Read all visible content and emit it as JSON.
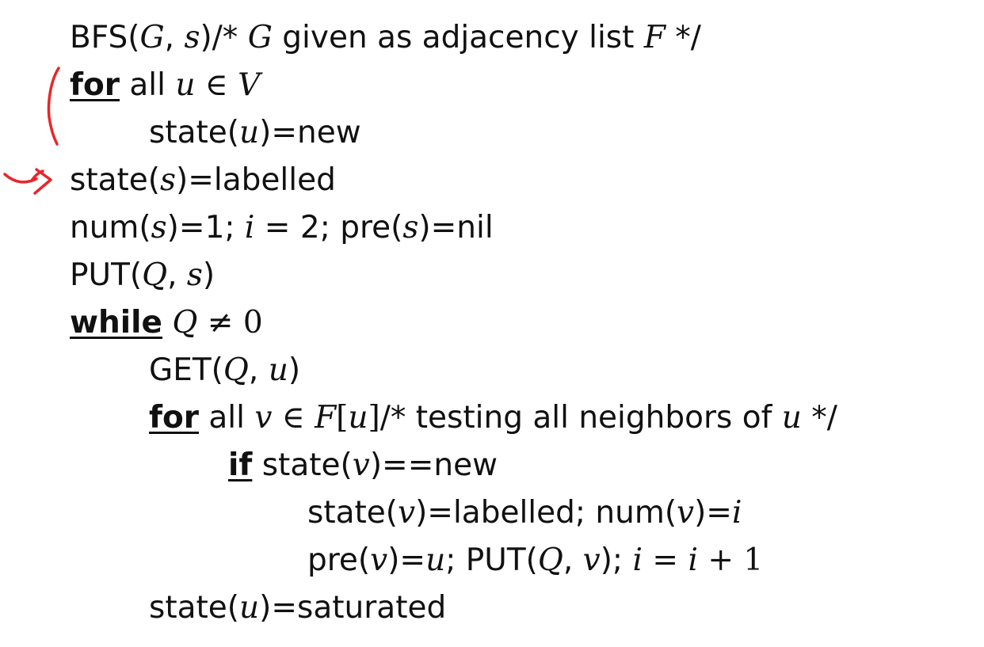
{
  "lines": [
    {
      "parts": [
        "BFS(",
        "G",
        ", ",
        "s",
        ")",
        "/* ",
        "G",
        " given as adjacency list ",
        "F",
        " */"
      ]
    },
    {
      "parts": [
        "for",
        " all ",
        "u",
        " ∈ ",
        "V"
      ]
    },
    {
      "parts": [
        "state(",
        "u",
        ")=new"
      ]
    },
    {
      "parts": [
        "state(",
        "s",
        ")=labelled"
      ]
    },
    {
      "parts": [
        "num(",
        "s",
        ")=1; ",
        "i",
        " = 2; pre(",
        "s",
        ")=nil"
      ]
    },
    {
      "parts": [
        "PUT(",
        "Q",
        ", ",
        "s",
        ")"
      ]
    },
    {
      "parts": [
        "while",
        " ",
        "Q",
        " ≠ 0"
      ]
    },
    {
      "parts": [
        "GET(",
        "Q",
        ", ",
        "u",
        ")"
      ]
    },
    {
      "parts": [
        "for",
        " all ",
        "v",
        " ∈ ",
        "F",
        "[",
        "u",
        "]",
        "/* testing all neighbors of ",
        "u",
        " */"
      ]
    },
    {
      "parts": [
        "if",
        " state(",
        "v",
        ")==new"
      ]
    },
    {
      "parts": [
        "state(",
        "v",
        ")=labelled; num(",
        "v",
        ")=",
        "i"
      ]
    },
    {
      "parts": [
        "pre(",
        "v",
        ")=",
        "u",
        "; PUT(",
        "Q",
        ", ",
        "v",
        "); ",
        "i",
        " = ",
        "i",
        " + 1"
      ]
    },
    {
      "parts": [
        "state(",
        "u",
        ")=saturated"
      ]
    }
  ],
  "annotation": {
    "color": "#e8262a"
  }
}
